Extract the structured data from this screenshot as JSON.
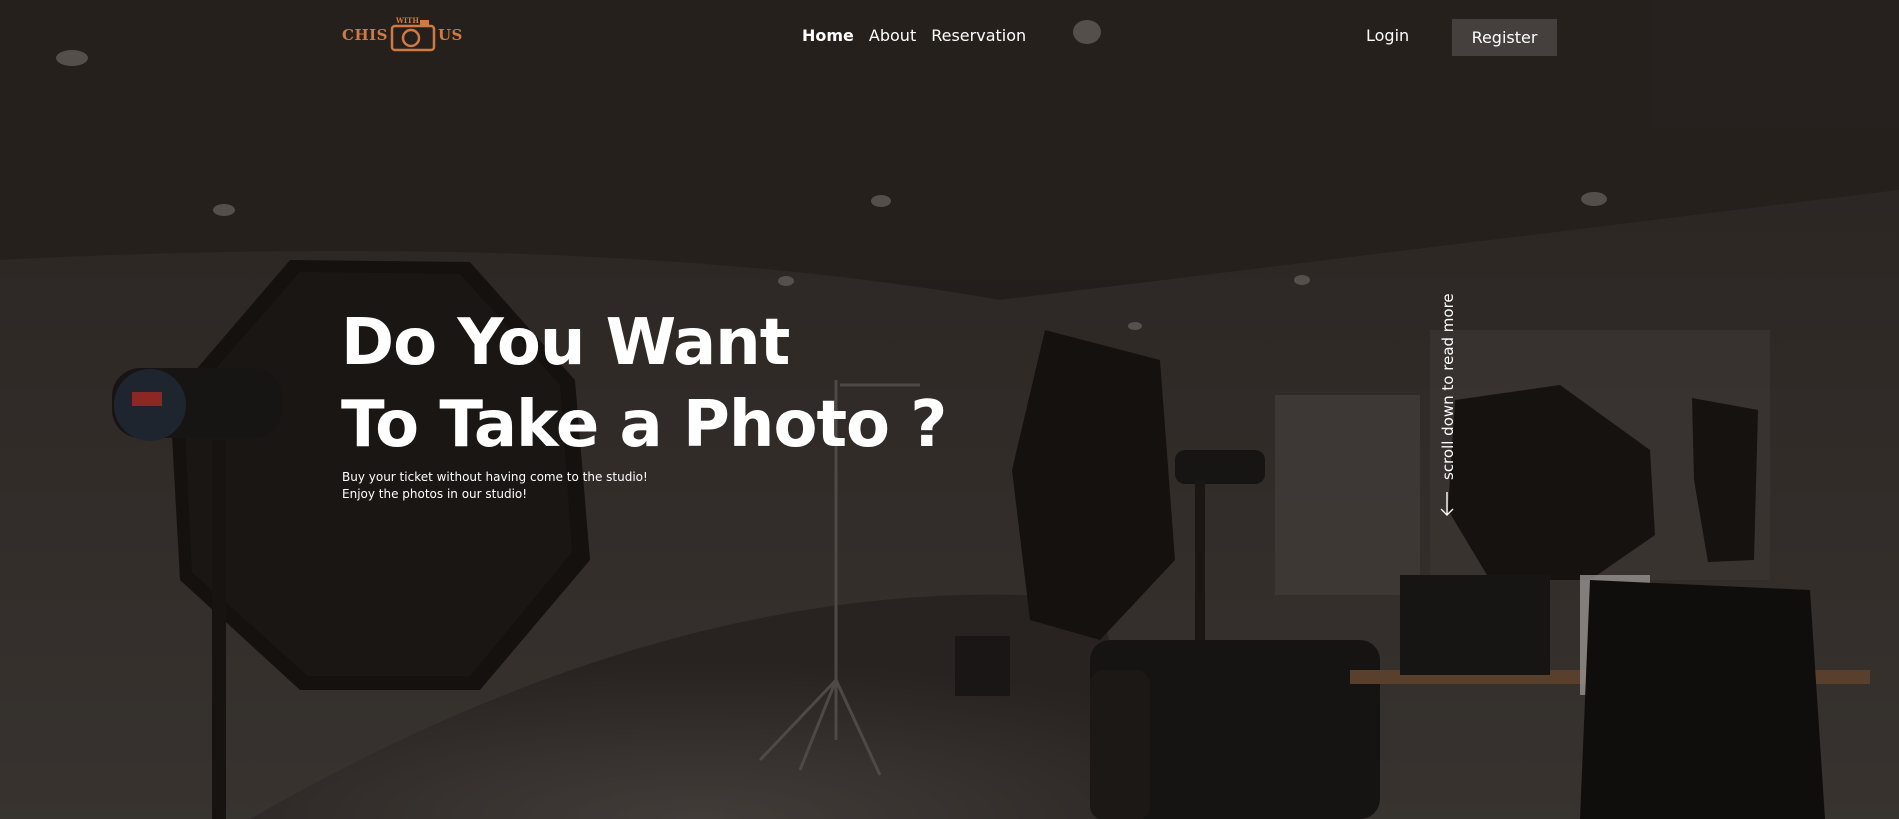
{
  "brand": {
    "left": "CHIS",
    "small": "WITH",
    "right": "US",
    "color": "#d07a42"
  },
  "nav": {
    "items": [
      {
        "label": "Home",
        "active": true
      },
      {
        "label": "About",
        "active": false
      },
      {
        "label": "Reservation",
        "active": false
      }
    ]
  },
  "auth": {
    "login_label": "Login",
    "register_label": "Register"
  },
  "hero": {
    "title_line1": "Do You Want",
    "title_line2": "To Take a Photo ?",
    "sub_line1": "Buy your ticket without having come to the studio!",
    "sub_line2": "Enjoy the photos in our studio!"
  },
  "scroll": {
    "label": "scroll down to read more",
    "icon": "arrow-down-icon"
  },
  "background": {
    "icon": "studio-photo",
    "tint": "#2c2623"
  }
}
